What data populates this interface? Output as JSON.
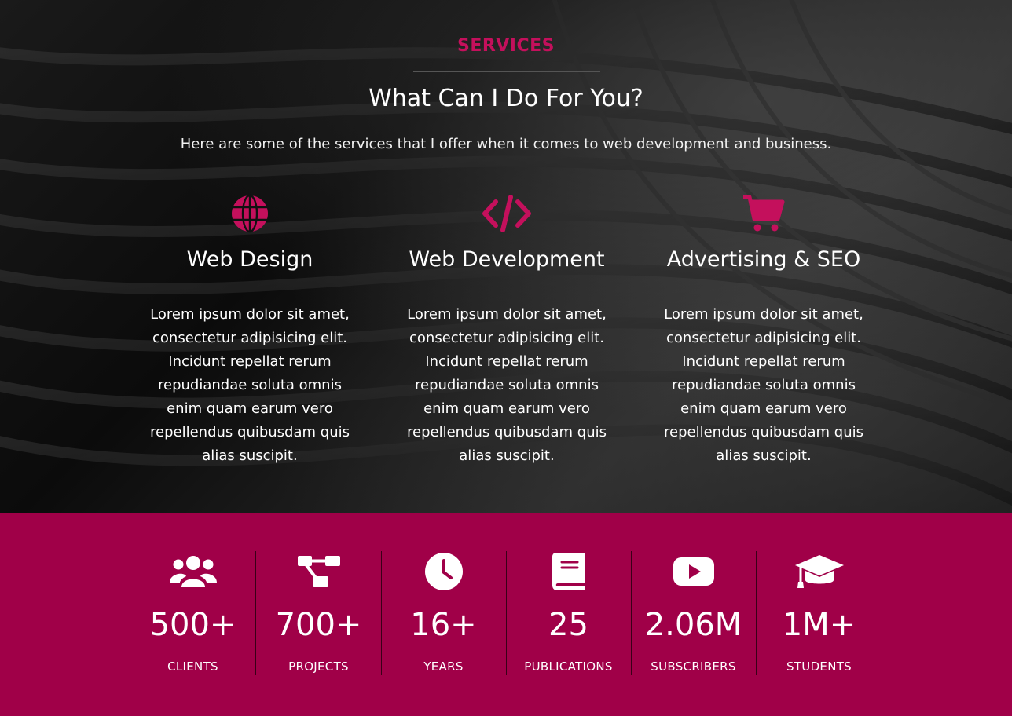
{
  "services": {
    "tag": "SERVICES",
    "title": "What Can I Do For You?",
    "subtitle": "Here are some of the services that I offer when it comes to web development and business.",
    "cards": [
      {
        "icon": "globe-icon",
        "title": "Web Design",
        "text": "Lorem ipsum dolor sit amet, consectetur adipisicing elit. Incidunt repellat rerum repudiandae soluta omnis enim quam earum vero repellendus quibusdam quis alias suscipit."
      },
      {
        "icon": "code-icon",
        "title": "Web Development",
        "text": "Lorem ipsum dolor sit amet, consectetur adipisicing elit. Incidunt repellat rerum repudiandae soluta omnis enim quam earum vero repellendus quibusdam quis alias suscipit."
      },
      {
        "icon": "shopping-cart-icon",
        "title": "Advertising & SEO",
        "text": "Lorem ipsum dolor sit amet, consectetur adipisicing elit. Incidunt repellat rerum repudiandae soluta omnis enim quam earum vero repellendus quibusdam quis alias suscipit."
      }
    ]
  },
  "stats": [
    {
      "icon": "users-icon",
      "value": "500+",
      "label": "CLIENTS"
    },
    {
      "icon": "project-diagram-icon",
      "value": "700+",
      "label": "PROJECTS"
    },
    {
      "icon": "clock-icon",
      "value": "16+",
      "label": "YEARS"
    },
    {
      "icon": "book-icon",
      "value": "25",
      "label": "PUBLICATIONS"
    },
    {
      "icon": "youtube-icon",
      "value": "2.06M",
      "label": "SUBSCRIBERS"
    },
    {
      "icon": "graduation-cap-icon",
      "value": "1M+",
      "label": "STUDENTS"
    }
  ],
  "colors": {
    "accent": "#c4105c",
    "stats_background": "#a00048",
    "text": "#ffffff"
  }
}
